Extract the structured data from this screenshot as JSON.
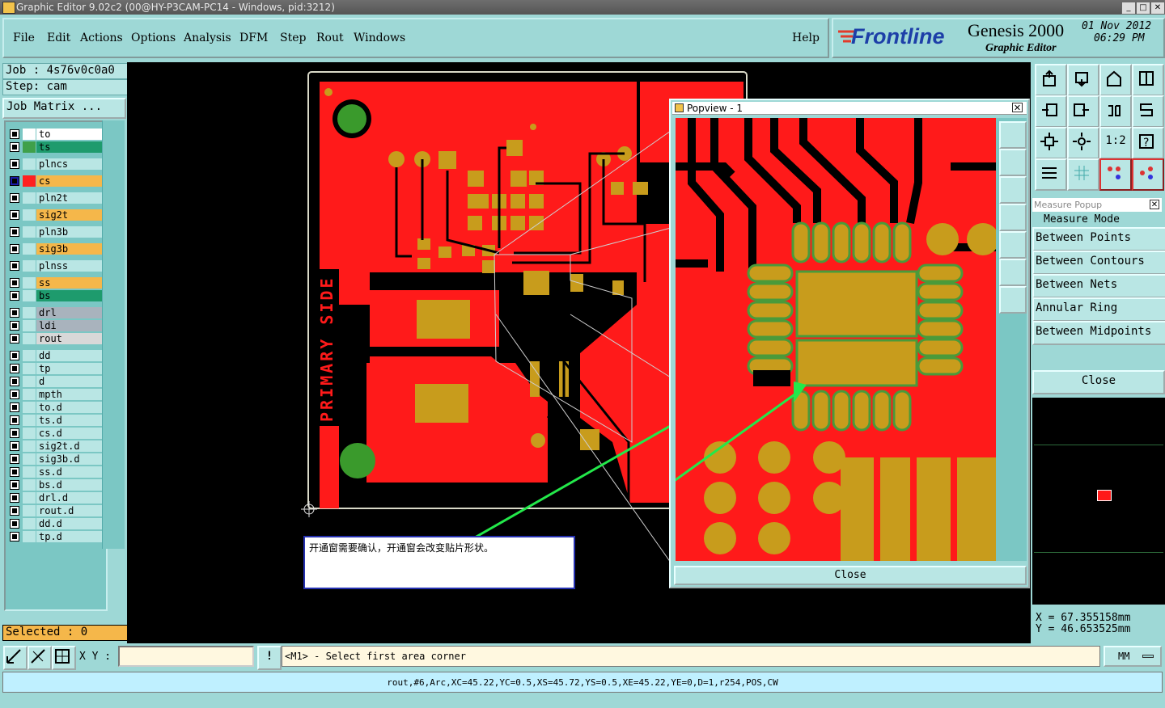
{
  "window": {
    "title": "Graphic Editor 9.02c2 (00@HY-P3CAM-PC14 - Windows, pid:3212)",
    "buttons": [
      "_",
      "□",
      "✕"
    ]
  },
  "menu": [
    "File",
    "Edit",
    "Actions",
    "Options",
    "Analysis",
    "DFM",
    "Step",
    "Rout",
    "Windows"
  ],
  "help_label": "Help",
  "brand": {
    "logo": "Frontline",
    "product": "Genesis 2000",
    "subtitle": "Graphic Editor",
    "date": "01 Nov 2012",
    "time": "06:29 PM"
  },
  "left": {
    "job": "Job : 4s76v0c0a0",
    "step": "Step: cam",
    "job_matrix": "Job Matrix ...",
    "selected": "Selected : 0",
    "layers": [
      {
        "name": "to",
        "color": "#ffffff",
        "bg": "#ffffff",
        "mark": "✎"
      },
      {
        "name": "ts",
        "color": "#3fa04a",
        "bg": "#1e9b6d"
      },
      {
        "name": "plncs",
        "color": "#b9e6e4",
        "bg": "#b9e6e4"
      },
      {
        "name": "cs",
        "color": "#ff2020",
        "bg": "#f5b74a",
        "active": true,
        "mark": "▣"
      },
      {
        "name": "pln2t",
        "color": "#b9e6e4",
        "bg": "#b9e6e4"
      },
      {
        "name": "sig2t",
        "color": "#b9e6e4",
        "bg": "#f5b74a"
      },
      {
        "name": "pln3b",
        "color": "#b9e6e4",
        "bg": "#b9e6e4"
      },
      {
        "name": "sig3b",
        "color": "#b9e6e4",
        "bg": "#f5b74a"
      },
      {
        "name": "plnss",
        "color": "#b9e6e4",
        "bg": "#b9e6e4"
      },
      {
        "name": "ss",
        "color": "#b9e6e4",
        "bg": "#f5b74a"
      },
      {
        "name": "bs",
        "color": "#b9e6e4",
        "bg": "#1e9b6d"
      },
      {
        "name": "drl",
        "color": "#b9e6e4",
        "bg": "#a9b3bd"
      },
      {
        "name": "ldi",
        "color": "#b9e6e4",
        "bg": "#a9b3bd"
      },
      {
        "name": "rout",
        "color": "#b9e6e4",
        "bg": "#d8d8d8"
      },
      {
        "name": "dd",
        "color": "#b9e6e4",
        "bg": "#b9e6e4"
      },
      {
        "name": "tp",
        "color": "#b9e6e4",
        "bg": "#b9e6e4"
      },
      {
        "name": "d",
        "color": "#b9e6e4",
        "bg": "#b9e6e4"
      },
      {
        "name": "mpth",
        "color": "#b9e6e4",
        "bg": "#b9e6e4"
      },
      {
        "name": "to.d",
        "color": "#b9e6e4",
        "bg": "#b9e6e4",
        "mark": "✎"
      },
      {
        "name": "ts.d",
        "color": "#b9e6e4",
        "bg": "#b9e6e4"
      },
      {
        "name": "cs.d",
        "color": "#b9e6e4",
        "bg": "#b9e6e4"
      },
      {
        "name": "sig2t.d",
        "color": "#b9e6e4",
        "bg": "#b9e6e4"
      },
      {
        "name": "sig3b.d",
        "color": "#b9e6e4",
        "bg": "#b9e6e4"
      },
      {
        "name": "ss.d",
        "color": "#b9e6e4",
        "bg": "#b9e6e4"
      },
      {
        "name": "bs.d",
        "color": "#b9e6e4",
        "bg": "#b9e6e4"
      },
      {
        "name": "drl.d",
        "color": "#b9e6e4",
        "bg": "#b9e6e4"
      },
      {
        "name": "rout.d",
        "color": "#b9e6e4",
        "bg": "#b9e6e4"
      },
      {
        "name": "dd.d",
        "color": "#b9e6e4",
        "bg": "#b9e6e4"
      },
      {
        "name": "tp.d",
        "color": "#b9e6e4",
        "bg": "#b9e6e4"
      }
    ]
  },
  "canvas": {
    "silk_text": "PRIMARY SIDE",
    "annotation": "开通窗需要确认，开通窗会改变贴片形状。"
  },
  "popview": {
    "title": "Popview - 1",
    "close": "Close"
  },
  "measure": {
    "title": "Measure Popup",
    "mode": "Measure Mode",
    "items": [
      "Between Points",
      "Between Contours",
      "Between Nets",
      "Annular Ring",
      "Between Midpoints"
    ],
    "close": "Close"
  },
  "coords": {
    "x": "X = 67.355158mm",
    "y": "Y = 46.653525mm"
  },
  "bottom": {
    "xy_label": "X Y :",
    "xy_value": "",
    "prompt": "<M1> - Select first area corner",
    "units": "MM",
    "status": "rout,#6,Arc,XC=45.22,YC=0.5,XS=45.72,YS=0.5,XE=45.22,YE=0,D=1,r254,POS,CW"
  },
  "colors": {
    "copper": "#ff1a1a",
    "pad": "#c89c1c",
    "pad_outline": "#4a9a3a",
    "trace_void": "#000000",
    "arrow": "#23e84a"
  }
}
